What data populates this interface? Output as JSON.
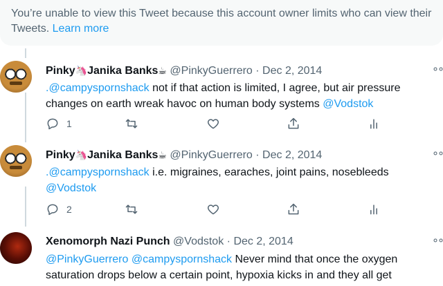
{
  "notice": {
    "text": "You’re unable to view this Tweet because this account owner limits who can view their Tweets.",
    "link": "Learn more"
  },
  "tweets": [
    {
      "name_a": "Pinky",
      "emoji_a": "🦄",
      "name_b": "Janika Banks",
      "emoji_b": "☕",
      "handle": "@PinkyGuerrero",
      "sep": "·",
      "date": "Dec 2, 2014",
      "mention": ".@campysporn​shack",
      "text": " not if that action is limited, I agree, but air pressure changes on earth wreak havoc on human body systems ",
      "mention2": "@Vodstok",
      "reply_count": "1",
      "more": "∘∘"
    },
    {
      "name_a": "Pinky",
      "emoji_a": "🦄",
      "name_b": "Janika Banks",
      "emoji_b": "☕",
      "handle": "@PinkyGuerrero",
      "sep": "·",
      "date": "Dec 2, 2014",
      "mention": ".@campysporn​shack",
      "text": " i.e. migraines, earaches, joint pains, nosebleeds ",
      "mention2": "@Vodstok",
      "reply_count": "2",
      "more": "∘∘"
    },
    {
      "name": "Xenomorph Nazi Punch",
      "handle": "@Vodstok",
      "sep": "·",
      "date": "Dec 2, 2014",
      "mention": "@PinkyGuerrero",
      "mention_b": "@campysporn​shack",
      "text": " Never mind that once the oxygen saturation drops below a certain point, hypoxia kicks in and they all get",
      "more": "∘∘"
    }
  ],
  "icons": [
    "reply-icon",
    "retweet-icon",
    "like-icon",
    "share-icon",
    "analytics-icon",
    "more-icon"
  ],
  "colors": {
    "link": "#1d9bf0",
    "muted": "#536471",
    "notice_bg": "#f7f9f9"
  }
}
